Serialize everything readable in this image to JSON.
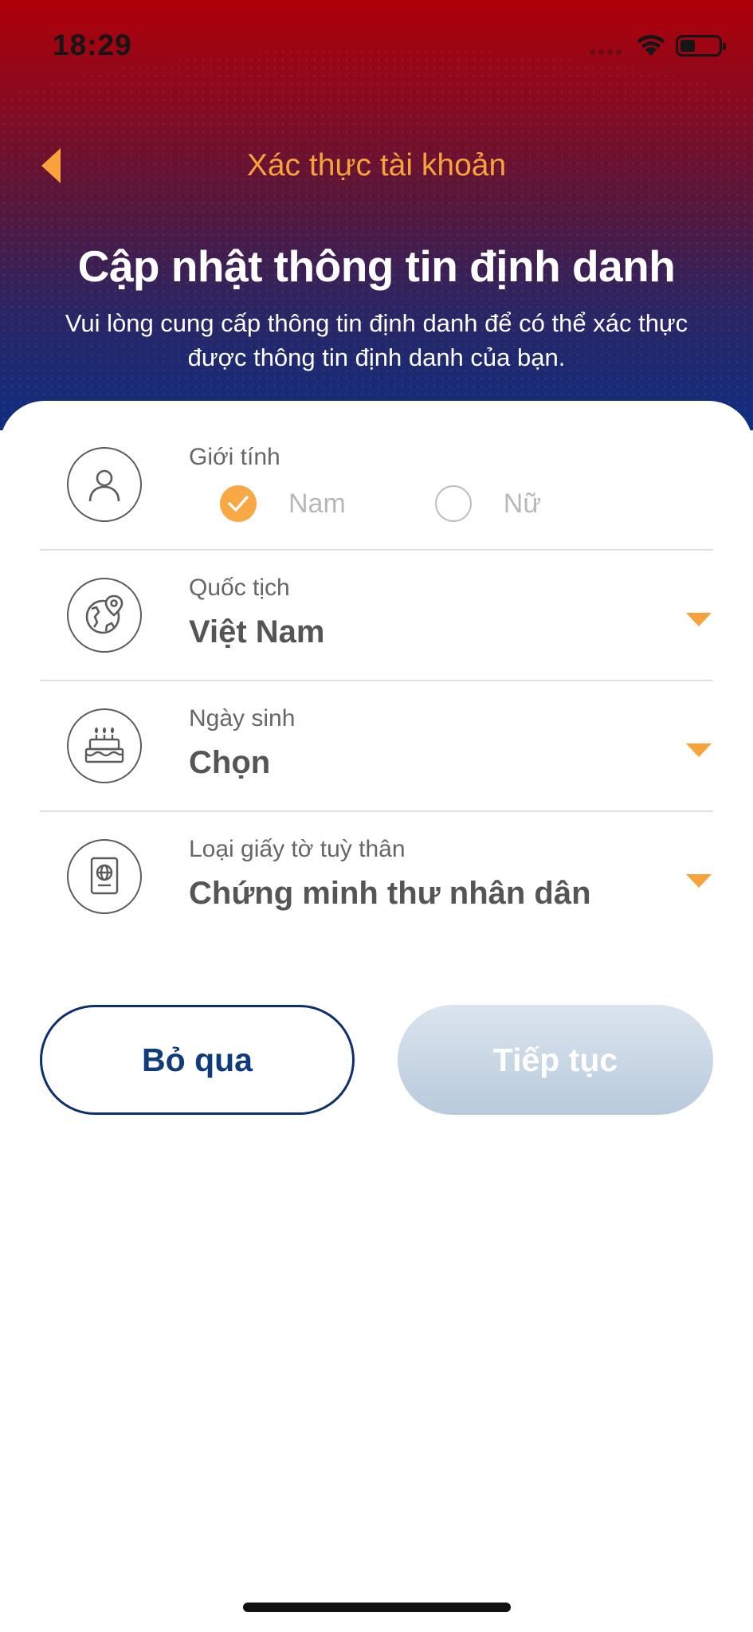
{
  "status_bar": {
    "time": "18:29"
  },
  "header": {
    "back_icon": "chevron-left-icon",
    "nav_title": "Xác thực tài khoản",
    "title": "Cập nhật thông tin định danh",
    "subtitle": "Vui lòng cung cấp thông tin định danh để có thể xác thực được thông tin định danh của bạn."
  },
  "form": {
    "gender": {
      "icon": "user-icon",
      "label": "Giới tính",
      "options": [
        {
          "label": "Nam",
          "selected": true
        },
        {
          "label": "Nữ",
          "selected": false
        }
      ]
    },
    "nationality": {
      "icon": "globe-location-icon",
      "label": "Quốc tịch",
      "value": "Việt Nam"
    },
    "birthdate": {
      "icon": "birthday-cake-icon",
      "label": "Ngày sinh",
      "value": "Chọn"
    },
    "id_type": {
      "icon": "passport-icon",
      "label": "Loại giấy tờ tuỳ thân",
      "value": "Chứng minh thư nhân dân"
    }
  },
  "actions": {
    "skip_label": "Bỏ qua",
    "next_label": "Tiếp tục"
  },
  "colors": {
    "accent": "#f7a23b",
    "primary_navy": "#0e2f6e",
    "disabled_button": "#b8cadc",
    "header_top": "#b00008",
    "header_bottom": "#0f2e80"
  }
}
